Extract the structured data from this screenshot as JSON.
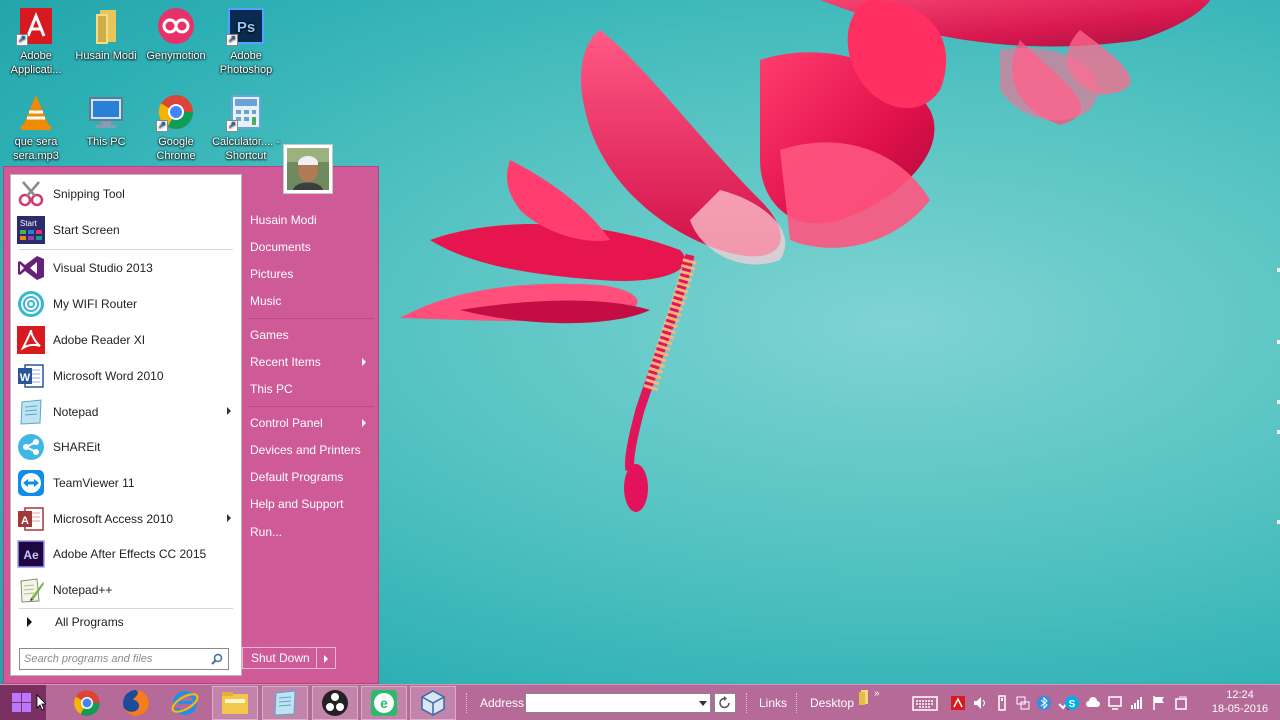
{
  "desktop": {
    "icons": [
      {
        "label": "Adobe Applicati...",
        "icon": "adobe-icon",
        "color": "#d71920"
      },
      {
        "label": "Husain Modi",
        "icon": "folder-icon",
        "color": "#e8c65a"
      },
      {
        "label": "Genymotion",
        "icon": "genymotion-icon",
        "color": "#e6316b"
      },
      {
        "label": "Adobe Photoshop",
        "icon": "photoshop-icon",
        "color": "#1f4e8c"
      },
      {
        "label": "que sera sera.mp3",
        "icon": "vlc-icon",
        "color": "#f08a00"
      },
      {
        "label": "This PC",
        "icon": "computer-icon",
        "color": "#2c7fd6"
      },
      {
        "label": "Google Chrome",
        "icon": "chrome-icon",
        "color": "#4caf50"
      },
      {
        "label": "Calculator.... - Shortcut",
        "icon": "calculator-icon",
        "color": "#6aa3d8"
      }
    ]
  },
  "start_menu": {
    "programs": [
      {
        "label": "Snipping Tool",
        "icon": "scissors-icon",
        "has_submenu": false
      },
      {
        "label": "Start Screen",
        "icon": "start-screen-icon",
        "has_submenu": false
      },
      {
        "label": "Visual Studio 2013",
        "icon": "visual-studio-icon",
        "has_submenu": false
      },
      {
        "label": "My WIFI Router",
        "icon": "wifi-icon",
        "has_submenu": false
      },
      {
        "label": "Adobe Reader XI",
        "icon": "adobe-reader-icon",
        "has_submenu": false
      },
      {
        "label": "Microsoft Word 2010",
        "icon": "word-icon",
        "has_submenu": false
      },
      {
        "label": "Notepad",
        "icon": "notepad-icon",
        "has_submenu": true
      },
      {
        "label": "SHAREit",
        "icon": "shareit-icon",
        "has_submenu": false
      },
      {
        "label": "TeamViewer 11",
        "icon": "teamviewer-icon",
        "has_submenu": false
      },
      {
        "label": "Microsoft Access 2010",
        "icon": "access-icon",
        "has_submenu": true
      },
      {
        "label": "Adobe After Effects CC 2015",
        "icon": "after-effects-icon",
        "has_submenu": false
      },
      {
        "label": "Notepad++",
        "icon": "notepad-plus-icon",
        "has_submenu": false
      }
    ],
    "start_screen_icon_text": "Start",
    "after_effects_icon_text": "Ae",
    "all_programs": "All Programs",
    "search_placeholder": "Search programs and files",
    "right_items": [
      {
        "label": "Husain Modi",
        "has_submenu": false
      },
      {
        "label": "Documents",
        "has_submenu": false
      },
      {
        "label": "Pictures",
        "has_submenu": false
      },
      {
        "label": "Music",
        "has_submenu": false
      },
      {
        "label": "Games",
        "has_submenu": false
      },
      {
        "label": "Recent Items",
        "has_submenu": true
      },
      {
        "label": "This PC",
        "has_submenu": false
      },
      {
        "label": "Control Panel",
        "has_submenu": true
      },
      {
        "label": "Devices and Printers",
        "has_submenu": false
      },
      {
        "label": "Default Programs",
        "has_submenu": false
      },
      {
        "label": "Help and Support",
        "has_submenu": false
      },
      {
        "label": "Run...",
        "has_submenu": false
      }
    ],
    "shutdown_label": "Shut Down",
    "accent": "#cf5a98"
  },
  "taskbar": {
    "pinned": [
      {
        "icon": "chrome-icon"
      },
      {
        "icon": "firefox-icon"
      },
      {
        "icon": "internet-explorer-icon"
      },
      {
        "icon": "file-explorer-icon"
      },
      {
        "icon": "notepad-icon"
      },
      {
        "icon": "obs-icon"
      },
      {
        "icon": "edge-green-icon"
      },
      {
        "icon": "virtualbox-icon"
      }
    ],
    "address_label": "Address",
    "address_value": "",
    "links_label": "Links",
    "desktop_label": "Desktop",
    "clock_time": "12:24",
    "clock_date": "18-05-2016",
    "color": "#b56a98"
  }
}
